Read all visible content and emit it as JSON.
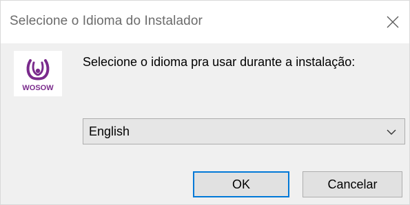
{
  "window": {
    "title": "Selecione o Idioma do Instalador",
    "close_icon": "close-icon"
  },
  "logo": {
    "icon": "wosow-logo",
    "text": "WOSOW",
    "brand_color": "#7a2a8c"
  },
  "message": "Selecione o idioma pra usar durante a instalação:",
  "language_select": {
    "selected": "English",
    "icon": "chevron-down-icon"
  },
  "buttons": {
    "ok_label": "OK",
    "cancel_label": "Cancelar"
  },
  "colors": {
    "accent": "#0078d7",
    "background": "#f0f0f0"
  }
}
